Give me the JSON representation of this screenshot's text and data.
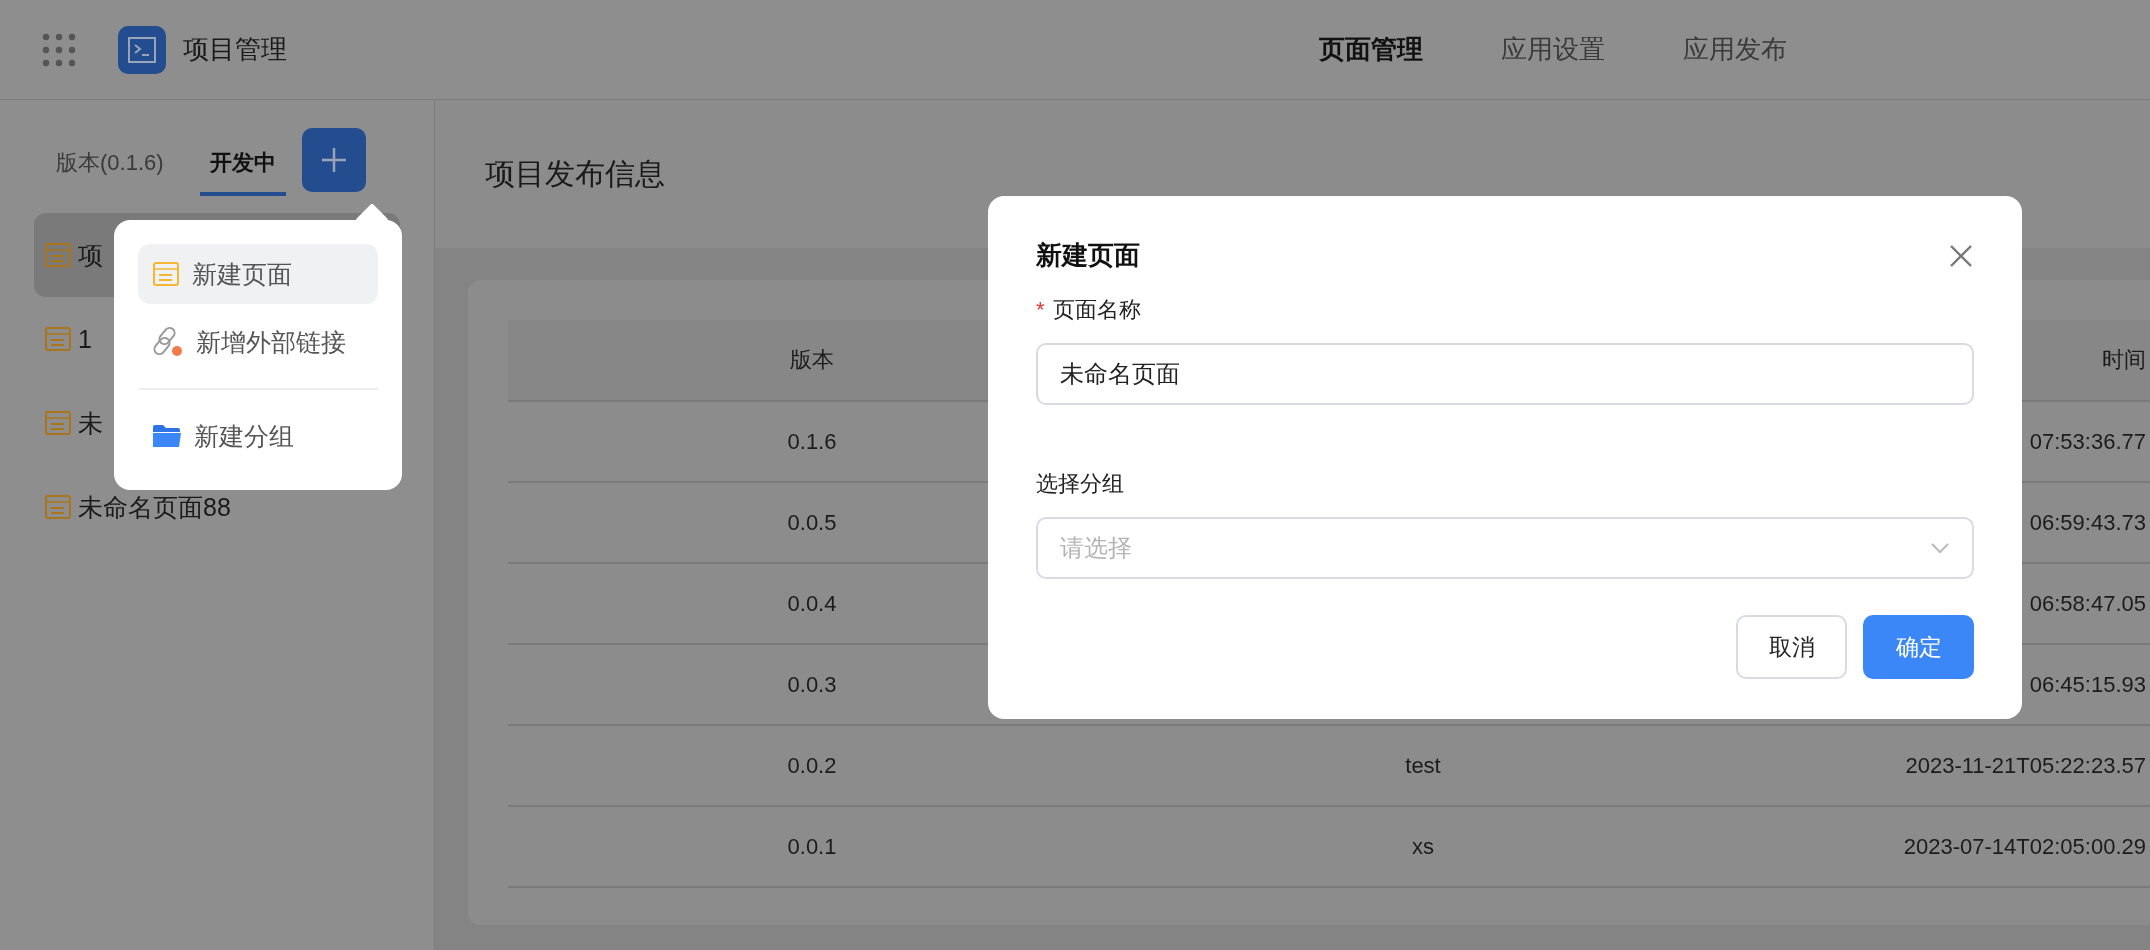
{
  "header": {
    "app_title": "项目管理",
    "nav": [
      {
        "label": "页面管理",
        "selected": true
      },
      {
        "label": "应用设置",
        "selected": false
      },
      {
        "label": "应用发布",
        "selected": false
      }
    ]
  },
  "sidebar": {
    "tabs": [
      {
        "label": "版本(0.1.6)",
        "selected": false
      },
      {
        "label": "开发中",
        "selected": true
      }
    ],
    "items": [
      {
        "label": "项",
        "selected": true
      },
      {
        "label": "1",
        "selected": false
      },
      {
        "label": "未",
        "selected": false
      },
      {
        "label": "未命名页面88",
        "selected": false
      }
    ]
  },
  "add_menu": {
    "items": [
      {
        "kind": "page",
        "label": "新建页面",
        "selected": true
      },
      {
        "kind": "link",
        "label": "新增外部链接",
        "selected": false
      },
      {
        "kind": "group",
        "label": "新建分组",
        "selected": false
      }
    ]
  },
  "main": {
    "title": "项目发布信息",
    "table": {
      "columns": [
        {
          "label": "版本"
        },
        {},
        {
          "label": "时间"
        }
      ],
      "rows": [
        {
          "version": "0.1.6",
          "column_3": "07:53:36.77"
        },
        {
          "version": "0.0.5",
          "column_3": "06:59:43.73"
        },
        {
          "version": "0.0.4",
          "column_3": "06:58:47.05"
        },
        {
          "version": "0.0.3",
          "column_3": "06:45:15.93"
        },
        {
          "version": "0.0.2",
          "column_2": "test",
          "column_3": "2023-11-21T05:22:23.57"
        },
        {
          "version": "0.0.1",
          "column_2": "xs",
          "column_3": "2023-07-14T02:05:00.29"
        }
      ]
    }
  },
  "dialog": {
    "title": "新建页面",
    "fields": [
      {
        "kind": "text",
        "label": "页面名称",
        "required_mark": "*",
        "value": "未命名页面"
      },
      {
        "kind": "select",
        "label": "选择分组",
        "placeholder": "请选择"
      }
    ],
    "buttons": [
      {
        "kind": "secondary",
        "label": "取消"
      },
      {
        "kind": "primary",
        "label": "确定"
      }
    ]
  }
}
